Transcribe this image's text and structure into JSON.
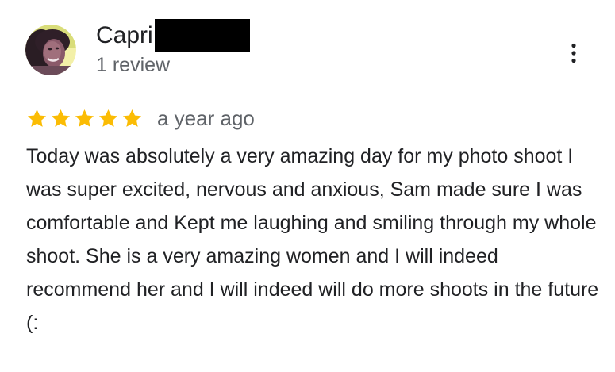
{
  "reviewer": {
    "name": "Capri",
    "review_count": "1 review",
    "avatar_icon": "profile-photo",
    "name_redacted": true
  },
  "review": {
    "rating": 5,
    "rating_max": 5,
    "star_color": "#fbbc04",
    "date": "a year ago",
    "text": "Today was absolutely a very amazing day for my photo shoot I was super excited, nervous and anxious, Sam made sure I was comfortable and Kept me laughing and smiling through my whole shoot. She is a very amazing women and I will indeed recommend her and I will indeed will do more shoots in the future (:"
  },
  "actions": {
    "more_icon": "more-vert-icon"
  },
  "colors": {
    "primary_text": "#202124",
    "secondary_text": "#5f6368",
    "star": "#fbbc04"
  }
}
